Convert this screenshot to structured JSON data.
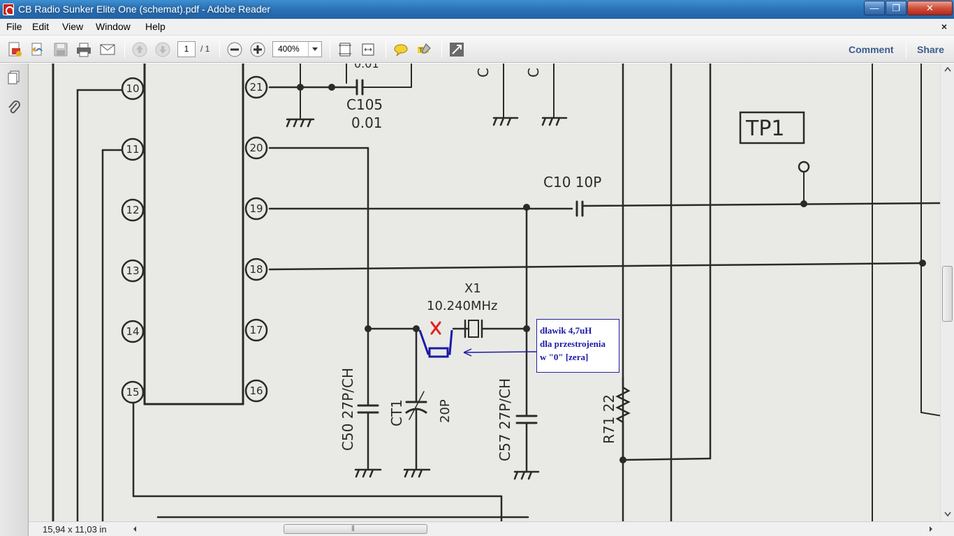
{
  "window": {
    "title": "CB Radio Sunker Elite One (schemat).pdf - Adobe Reader",
    "controls": {
      "minimize": "—",
      "maximize": "❐",
      "close": "✕"
    }
  },
  "menu": {
    "items": [
      "File",
      "Edit",
      "View",
      "Window",
      "Help"
    ],
    "close_doc": "×"
  },
  "toolbar": {
    "page_current": "1",
    "page_total": "/ 1",
    "zoom": "400%",
    "comment": "Comment",
    "share": "Share"
  },
  "status": {
    "page_size": "15,94 x 11,03 in"
  },
  "schematic": {
    "pins_left": [
      "10",
      "11",
      "12",
      "13",
      "14",
      "15"
    ],
    "pins_right": [
      "21",
      "20",
      "19",
      "18",
      "17",
      "16"
    ],
    "labels": {
      "c105": "C105",
      "c105_value": "0.01",
      "c_partial_1": "C",
      "c_partial_2": "C",
      "tp1": "TP1",
      "c10": "C10 10P",
      "x1": "X1",
      "x1_freq": "10.240MHz",
      "c50": "C50 27P/CH",
      "ct1": "CT1",
      "ct1_value": "20P",
      "c57": "C57 27P/CH",
      "r71": "R71 22",
      "top_partial": "0.01"
    },
    "annotation": {
      "lines": [
        "dławik 4,7uH",
        "dla przestrojenia",
        "w \"0\" [zera]"
      ],
      "color": "#1a1aa8",
      "mark_color": "#e02020"
    }
  }
}
